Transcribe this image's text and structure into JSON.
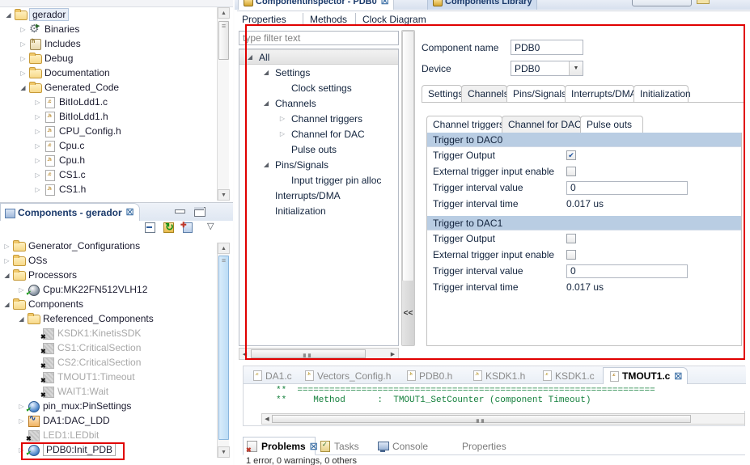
{
  "project_explorer": {
    "items": [
      {
        "label": "gerador",
        "indent": 0,
        "arrow": "expanded",
        "icon": "project-folder-icon",
        "selected": true
      },
      {
        "label": "Binaries",
        "indent": 1,
        "arrow": "collapsed",
        "icon": "binaries-icon",
        "selected": false
      },
      {
        "label": "Includes",
        "indent": 1,
        "arrow": "collapsed",
        "icon": "includes-icon",
        "selected": false
      },
      {
        "label": "Debug",
        "indent": 1,
        "arrow": "collapsed",
        "icon": "folder-icon",
        "selected": false
      },
      {
        "label": "Documentation",
        "indent": 1,
        "arrow": "collapsed",
        "icon": "folder-icon",
        "selected": false
      },
      {
        "label": "Generated_Code",
        "indent": 1,
        "arrow": "expanded",
        "icon": "folder-icon",
        "selected": false
      },
      {
        "label": "BitIoLdd1.c",
        "indent": 2,
        "arrow": "collapsed",
        "icon": "c-file-icon",
        "ext": ".c",
        "selected": false
      },
      {
        "label": "BitIoLdd1.h",
        "indent": 2,
        "arrow": "collapsed",
        "icon": "h-file-icon",
        "ext": ".h",
        "selected": false
      },
      {
        "label": "CPU_Config.h",
        "indent": 2,
        "arrow": "collapsed",
        "icon": "h-file-icon",
        "ext": ".h",
        "selected": false
      },
      {
        "label": "Cpu.c",
        "indent": 2,
        "arrow": "collapsed",
        "icon": "c-file-icon",
        "ext": ".c",
        "selected": false
      },
      {
        "label": "Cpu.h",
        "indent": 2,
        "arrow": "collapsed",
        "icon": "h-file-icon",
        "ext": ".h",
        "selected": false
      },
      {
        "label": "CS1.c",
        "indent": 2,
        "arrow": "collapsed",
        "icon": "c-file-icon",
        "ext": ".c",
        "selected": false
      },
      {
        "label": "CS1.h",
        "indent": 2,
        "arrow": "collapsed",
        "icon": "h-file-icon",
        "ext": ".h",
        "selected": false
      }
    ]
  },
  "components_view": {
    "tab_title": "Components - gerador",
    "close_glyph": "☒",
    "toolbar": {
      "minimize": "minimize-icon",
      "maximize": "maximize-icon",
      "collapse_all": "collapse-all-icon",
      "refresh": "refresh-icon",
      "new_component": "new-component-icon",
      "view_menu": "view-menu-icon"
    },
    "items": [
      {
        "label": "Generator_Configurations",
        "indent": 0,
        "arrow": "collapsed",
        "icon": "folder-icon",
        "disabled": false
      },
      {
        "label": "OSs",
        "indent": 0,
        "arrow": "collapsed",
        "icon": "folder-icon",
        "disabled": false
      },
      {
        "label": "Processors",
        "indent": 0,
        "arrow": "expanded",
        "icon": "folder-icon",
        "disabled": false
      },
      {
        "label": "Cpu:MK22FN512VLH12",
        "indent": 1,
        "arrow": "collapsed",
        "icon": "cpu-icon",
        "disabled": false
      },
      {
        "label": "Components",
        "indent": 0,
        "arrow": "expanded",
        "icon": "folder-icon",
        "disabled": false
      },
      {
        "label": "Referenced_Components",
        "indent": 1,
        "arrow": "expanded",
        "icon": "folder-icon",
        "disabled": false
      },
      {
        "label": "KSDK1:KinetisSDK",
        "indent": 2,
        "arrow": "blank",
        "icon": "disabled-component-icon",
        "disabled": true
      },
      {
        "label": "CS1:CriticalSection",
        "indent": 2,
        "arrow": "blank",
        "icon": "disabled-component-icon",
        "disabled": true
      },
      {
        "label": "CS2:CriticalSection",
        "indent": 2,
        "arrow": "blank",
        "icon": "disabled-component-icon",
        "disabled": true
      },
      {
        "label": "TMOUT1:Timeout",
        "indent": 2,
        "arrow": "blank",
        "icon": "disabled-component-icon",
        "disabled": true
      },
      {
        "label": "WAIT1:Wait",
        "indent": 2,
        "arrow": "blank",
        "icon": "disabled-component-icon",
        "disabled": true
      },
      {
        "label": "pin_mux:PinSettings",
        "indent": 1,
        "arrow": "collapsed",
        "icon": "component-icon",
        "disabled": false
      },
      {
        "label": "DA1:DAC_LDD",
        "indent": 1,
        "arrow": "collapsed",
        "icon": "dac-icon",
        "disabled": false
      },
      {
        "label": "LED1:LEDbit",
        "indent": 1,
        "arrow": "blank",
        "icon": "disabled-component-icon",
        "disabled": true
      },
      {
        "label": "PDB0:Init_PDB",
        "indent": 1,
        "arrow": "collapsed",
        "icon": "component-icon",
        "disabled": false,
        "highlighted": true
      }
    ]
  },
  "inspector": {
    "tabs": [
      {
        "label": "ComponentInspector - PDB0",
        "active": true
      },
      {
        "label": "Components Library",
        "active": false
      }
    ],
    "page_tabs": [
      {
        "label": "Properties",
        "active": true
      },
      {
        "label": "Methods",
        "active": false
      },
      {
        "label": "Clock Diagram",
        "active": false
      }
    ],
    "filter": {
      "placeholder": "type filter text",
      "value": ""
    },
    "collapse_button_label": "<<",
    "property_tree": [
      {
        "label": "All",
        "indent": 0,
        "arrow": "expanded",
        "selected": true
      },
      {
        "label": "Settings",
        "indent": 1,
        "arrow": "expanded",
        "selected": false
      },
      {
        "label": "Clock settings",
        "indent": 2,
        "arrow": "blank",
        "selected": false
      },
      {
        "label": "Channels",
        "indent": 1,
        "arrow": "expanded",
        "selected": false
      },
      {
        "label": "Channel triggers",
        "indent": 2,
        "arrow": "collapsed",
        "selected": false
      },
      {
        "label": "Channel for DAC",
        "indent": 2,
        "arrow": "collapsed",
        "selected": false
      },
      {
        "label": "Pulse outs",
        "indent": 2,
        "arrow": "blank",
        "selected": false
      },
      {
        "label": "Pins/Signals",
        "indent": 1,
        "arrow": "expanded",
        "selected": false
      },
      {
        "label": "Input trigger pin alloc",
        "indent": 2,
        "arrow": "blank",
        "selected": false
      },
      {
        "label": "Interrupts/DMA",
        "indent": 1,
        "arrow": "blank",
        "selected": false
      },
      {
        "label": "Initialization",
        "indent": 1,
        "arrow": "blank",
        "selected": false
      }
    ],
    "fields": {
      "component_name_label": "Component name",
      "component_name_value": "PDB0",
      "device_label": "Device",
      "device_value": "PDB0"
    },
    "inner_tabs": [
      {
        "label": "Settings",
        "active": false
      },
      {
        "label": "Channels",
        "active": true
      },
      {
        "label": "Pins/Signals",
        "active": false
      },
      {
        "label": "Interrupts/DMA",
        "active": false
      },
      {
        "label": "Initialization",
        "active": false
      }
    ],
    "sub_tabs": [
      {
        "label": "Channel triggers",
        "active": false
      },
      {
        "label": "Channel for DAC",
        "active": true
      },
      {
        "label": "Pulse outs",
        "active": false
      }
    ],
    "groups": [
      {
        "title": "Trigger to DAC0",
        "rows": [
          {
            "label": "Trigger Output",
            "type": "checkbox",
            "checked": true
          },
          {
            "label": "External trigger input enable",
            "type": "checkbox",
            "checked": false
          },
          {
            "label": "Trigger interval value",
            "type": "textbox",
            "value": "0"
          },
          {
            "label": "Trigger interval time",
            "type": "text",
            "value": "0.017 us"
          }
        ]
      },
      {
        "title": "Trigger to DAC1",
        "rows": [
          {
            "label": "Trigger Output",
            "type": "checkbox",
            "checked": false
          },
          {
            "label": "External trigger input enable",
            "type": "checkbox",
            "checked": false
          },
          {
            "label": "Trigger interval value",
            "type": "textbox",
            "value": "0"
          },
          {
            "label": "Trigger interval time",
            "type": "text",
            "value": "0.017 us"
          }
        ]
      }
    ]
  },
  "code_editor": {
    "file_tabs": [
      {
        "label": "DA1.c",
        "ext": ".c",
        "active": false
      },
      {
        "label": "Vectors_Config.h",
        "ext": ".h",
        "active": false
      },
      {
        "label": "PDB0.h",
        "ext": ".h",
        "active": false
      },
      {
        "label": "KSDK1.h",
        "ext": ".h",
        "active": false
      },
      {
        "label": "KSDK1.c",
        "ext": ".c",
        "active": false
      },
      {
        "label": "TMOUT1.c",
        "ext": ".c",
        "active": true
      }
    ],
    "close_glyph": "☒",
    "lines": [
      "**  ===================================================================",
      "**     Method      :  TMOUT1_SetCounter (component Timeout)"
    ]
  },
  "bottom_views": {
    "tabs": [
      {
        "label": "Problems",
        "icon": "problems-icon",
        "active": true
      },
      {
        "label": "Tasks",
        "icon": "tasks-icon",
        "active": false
      },
      {
        "label": "Console",
        "icon": "console-icon",
        "active": false
      },
      {
        "label": "Properties",
        "icon": "properties-icon",
        "active": false
      }
    ],
    "close_glyph": "☒",
    "status_text": "1 error, 0 warnings, 0 others"
  },
  "colors": {
    "highlight_red": "#e00000",
    "group_header_blue": "#b9cde3",
    "tab_blue": "#1b3a6b",
    "code_green": "#15803d"
  }
}
